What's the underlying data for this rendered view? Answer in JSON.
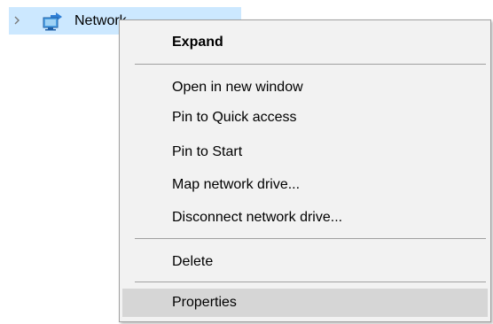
{
  "tree": {
    "label": "Network"
  },
  "icons": {
    "expand": "chevron-right-icon",
    "network": "network-icon"
  },
  "colors": {
    "selection": "#cce8ff",
    "menu_bg": "#f2f2f2",
    "menu_hover": "#d6d6d6"
  },
  "menu": {
    "items": [
      {
        "label": "Expand"
      },
      {
        "label": "Open in new window"
      },
      {
        "label": "Pin to Quick access"
      },
      {
        "label": "Pin to Start"
      },
      {
        "label": "Map network drive..."
      },
      {
        "label": "Disconnect network drive..."
      },
      {
        "label": "Delete"
      },
      {
        "label": "Properties"
      }
    ]
  }
}
